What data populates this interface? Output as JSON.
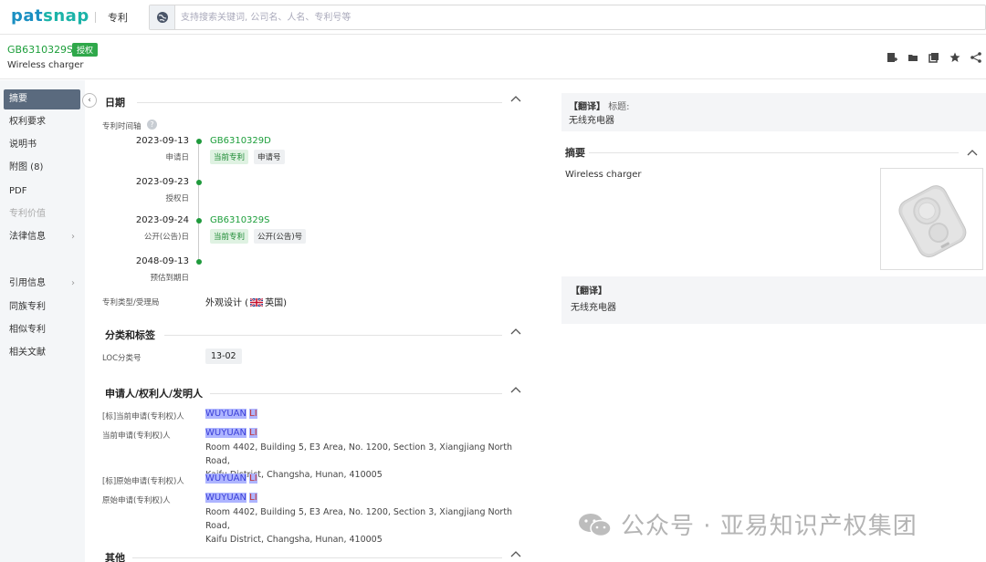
{
  "topbar": {
    "logo_main": "pat",
    "logo_accent": "snap",
    "product": "专利",
    "search_placeholder": "支持搜索关键词, 公司名、人名、专利号等"
  },
  "header": {
    "pub_number": "GB6310329S",
    "status_badge": "授权",
    "title": "Wireless charger"
  },
  "sidebar": {
    "items": [
      {
        "label": "摘要",
        "active": true
      },
      {
        "label": "权利要求"
      },
      {
        "label": "说明书"
      },
      {
        "label": "附图 (8)"
      },
      {
        "label": "PDF"
      },
      {
        "label": "专利价值",
        "disabled": true
      },
      {
        "label": "法律信息",
        "chevron": "›"
      },
      {
        "label": "引用信息",
        "chevron": "›"
      },
      {
        "label": "同族专利"
      },
      {
        "label": "相似专利"
      },
      {
        "label": "相关文献"
      }
    ]
  },
  "dates_section": {
    "title": "日期",
    "timeline_label": "专利时间轴",
    "events": [
      {
        "date": "2023-09-13",
        "sub": "申请日",
        "number": "GB6310329D",
        "tags": [
          "当前专利",
          "申请号"
        ]
      },
      {
        "date": "2023-09-23",
        "sub": "授权日"
      },
      {
        "date": "2023-09-24",
        "sub": "公开(公告)日",
        "number": "GB6310329S",
        "tags": [
          "当前专利",
          "公开(公告)号"
        ]
      },
      {
        "date": "2048-09-13",
        "sub": "预估到期日"
      }
    ],
    "type_label": "专利类型/受理局",
    "type_value": "外观设计 (",
    "office": "英国)"
  },
  "classification_section": {
    "title": "分类和标签",
    "loc_label": "LOC分类号",
    "loc_value": "13-02"
  },
  "applicants_section": {
    "title": "申请人/权利人/发明人",
    "rows": [
      {
        "label": "[标]当前申请(专利权)人",
        "name_first": "WUYUAN",
        "name_last": "LI"
      },
      {
        "label": "当前申请(专利权)人",
        "name_first": "WUYUAN",
        "name_last": "LI",
        "address_1": "Room 4402, Building 5, E3 Area, No. 1200, Section 3, Xiangjiang North Road,",
        "address_2": "Kaifu District, Changsha, Hunan, 410005"
      },
      {
        "label": "[标]原始申请(专利权)人",
        "name_first": "WUYUAN",
        "name_last": "LI"
      },
      {
        "label": "原始申请(专利权)人",
        "name_first": "WUYUAN",
        "name_last": "LI",
        "address_1": "Room 4402, Building 5, E3 Area, No. 1200, Section 3, Xiangjiang North Road,",
        "address_2": "Kaifu District, Changsha, Hunan, 410005"
      }
    ]
  },
  "other_section": {
    "title": "其他"
  },
  "right_panel": {
    "translate_title_prefix": "【翻译】",
    "translate_title_label": "标题:",
    "translated_title": "无线充电器",
    "abstract_title": "摘要",
    "abstract_text": "Wireless charger",
    "translate_abstract_prefix": "【翻译】",
    "translated_abstract": "无线充电器"
  },
  "watermark": {
    "text": "公众号 · 亚易知识产权集团"
  },
  "colors": {
    "brand_blue": "#1a8fc2",
    "brand_teal": "#1bb3a8",
    "green": "#1f9a3c",
    "sidebar_active": "#5a6a7e"
  }
}
